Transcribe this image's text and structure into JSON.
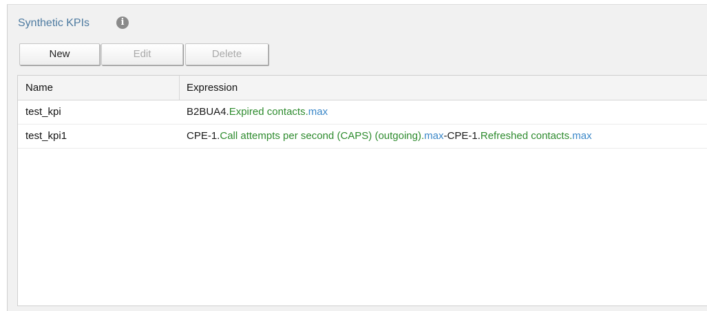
{
  "panel": {
    "title": "Synthetic KPIs",
    "info_icon": "i"
  },
  "toolbar": {
    "new_label": "New",
    "edit_label": "Edit",
    "delete_label": "Delete"
  },
  "table": {
    "columns": [
      "Name",
      "Expression"
    ],
    "rows": [
      {
        "name": "test_kpi",
        "expression": [
          {
            "text": "B2BUA4.",
            "kind": "entity"
          },
          {
            "text": "Expired contacts.",
            "kind": "metric"
          },
          {
            "text": "max",
            "kind": "agg"
          }
        ]
      },
      {
        "name": "test_kpi1",
        "expression": [
          {
            "text": "CPE-1.",
            "kind": "entity"
          },
          {
            "text": "Call attempts per second (CAPS) (outgoing).",
            "kind": "metric"
          },
          {
            "text": "max",
            "kind": "agg"
          },
          {
            "text": "-CPE-1.",
            "kind": "entity"
          },
          {
            "text": "Refreshed contacts.",
            "kind": "metric"
          },
          {
            "text": "max",
            "kind": "agg"
          }
        ]
      }
    ]
  },
  "colors": {
    "title": "#4d7aa0",
    "entity": "#1a1a1a",
    "metric": "#2e8b2e",
    "aggregate": "#3a87c8"
  }
}
